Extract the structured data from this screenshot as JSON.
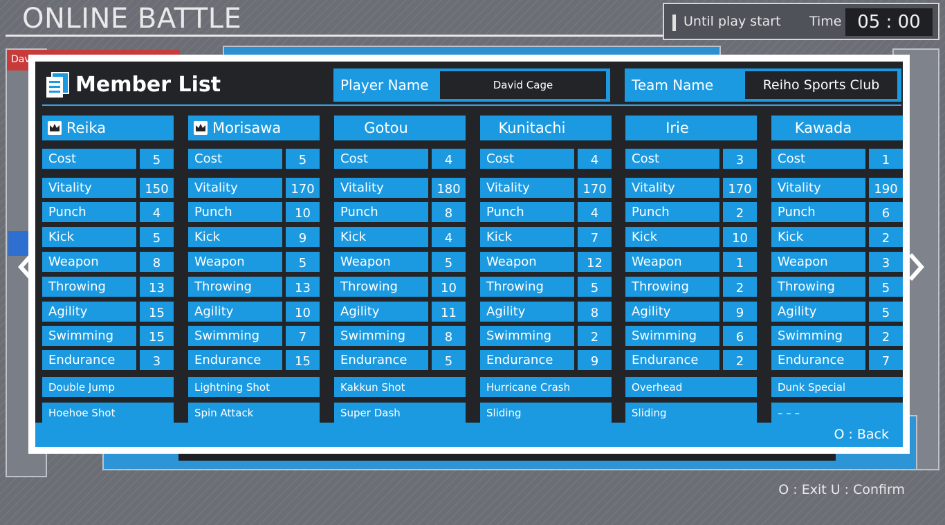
{
  "screen": {
    "title": "ONLINE BATTLE",
    "timer_label": "Until play start",
    "time_label": "Time",
    "time_value": "05 : 00",
    "bottom_hint": "O : Exit  U : Confirm",
    "bg_tag_text": "Davi"
  },
  "popup": {
    "title": "Member List",
    "player_name_label": "Player Name",
    "player_name_value": "David Cage",
    "team_name_label": "Team Name",
    "team_name_value": "Reiho Sports Club",
    "back_hint": "O : Back"
  },
  "stat_labels": {
    "cost": "Cost",
    "vitality": "Vitality",
    "punch": "Punch",
    "kick": "Kick",
    "weapon": "Weapon",
    "throwing": "Throwing",
    "agility": "Agility",
    "swimming": "Swimming",
    "endurance": "Endurance"
  },
  "members": [
    {
      "name": "Reika",
      "captain": true,
      "cost": "5",
      "vitality": "150",
      "punch": "4",
      "kick": "5",
      "weapon": "8",
      "throwing": "13",
      "agility": "15",
      "swimming": "15",
      "endurance": "3",
      "skill1": "Double Jump",
      "skill2": "Hoehoe Shot"
    },
    {
      "name": "Morisawa",
      "captain": true,
      "cost": "5",
      "vitality": "170",
      "punch": "10",
      "kick": "9",
      "weapon": "5",
      "throwing": "13",
      "agility": "10",
      "swimming": "7",
      "endurance": "15",
      "skill1": "Lightning Shot",
      "skill2": "Spin Attack"
    },
    {
      "name": "Gotou",
      "captain": false,
      "cost": "4",
      "vitality": "180",
      "punch": "8",
      "kick": "4",
      "weapon": "5",
      "throwing": "10",
      "agility": "11",
      "swimming": "8",
      "endurance": "5",
      "skill1": "Kakkun Shot",
      "skill2": "Super Dash"
    },
    {
      "name": "Kunitachi",
      "captain": false,
      "cost": "4",
      "vitality": "170",
      "punch": "4",
      "kick": "7",
      "weapon": "12",
      "throwing": "5",
      "agility": "8",
      "swimming": "2",
      "endurance": "9",
      "skill1": "Hurricane Crash",
      "skill2": "Sliding"
    },
    {
      "name": "Irie",
      "captain": false,
      "cost": "3",
      "vitality": "170",
      "punch": "2",
      "kick": "10",
      "weapon": "1",
      "throwing": "2",
      "agility": "9",
      "swimming": "6",
      "endurance": "2",
      "skill1": "Overhead",
      "skill2": "Sliding"
    },
    {
      "name": "Kawada",
      "captain": false,
      "cost": "1",
      "vitality": "190",
      "punch": "6",
      "kick": "2",
      "weapon": "3",
      "throwing": "5",
      "agility": "5",
      "swimming": "2",
      "endurance": "7",
      "skill1": "Dunk Special",
      "skill2": "– – –"
    }
  ],
  "icons": {
    "list": "document-list-icon",
    "crown": "crown-icon",
    "prev": "chevron-left-icon",
    "next": "chevron-right-icon"
  },
  "colors": {
    "accent_blue": "#1b9ae2",
    "panel_dark": "#232428",
    "frame_white": "#ffffff"
  }
}
